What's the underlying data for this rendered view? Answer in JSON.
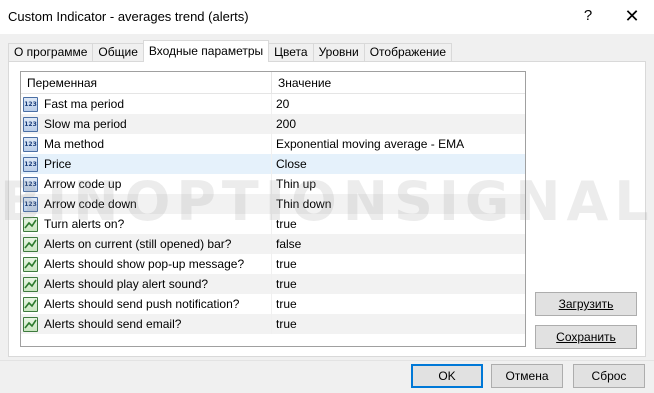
{
  "window": {
    "title": "Custom Indicator - averages trend (alerts)",
    "help_label": "?",
    "close_label": "✕"
  },
  "tabs": [
    {
      "label": "О программе",
      "active": false
    },
    {
      "label": "Общие",
      "active": false
    },
    {
      "label": "Входные параметры",
      "active": true
    },
    {
      "label": "Цвета",
      "active": false
    },
    {
      "label": "Уровни",
      "active": false
    },
    {
      "label": "Отображение",
      "active": false
    }
  ],
  "table": {
    "col_variable": "Переменная",
    "col_value": "Значение",
    "rows": [
      {
        "icon": "number-icon",
        "icon_text": "123",
        "name": "Fast ma period",
        "value": "20"
      },
      {
        "icon": "number-icon",
        "icon_text": "123",
        "name": "Slow ma period",
        "value": "200"
      },
      {
        "icon": "number-icon",
        "icon_text": "123",
        "name": "Ma method",
        "value": "Exponential moving average - EMA"
      },
      {
        "icon": "number-icon",
        "icon_text": "123",
        "name": "Price",
        "value": "Close"
      },
      {
        "icon": "number-icon",
        "icon_text": "123",
        "name": "Arrow code up",
        "value": "Thin up"
      },
      {
        "icon": "number-icon",
        "icon_text": "123",
        "name": "Arrow code down",
        "value": "Thin down"
      },
      {
        "icon": "bool-icon",
        "name": "Turn alerts on?",
        "value": "true"
      },
      {
        "icon": "bool-icon",
        "name": "Alerts on current (still opened) bar?",
        "value": "false"
      },
      {
        "icon": "bool-icon",
        "name": "Alerts should show pop-up message?",
        "value": "true"
      },
      {
        "icon": "bool-icon",
        "name": "Alerts should play alert sound?",
        "value": "true"
      },
      {
        "icon": "bool-icon",
        "name": "Alerts should send push notification?",
        "value": "true"
      },
      {
        "icon": "bool-icon",
        "name": "Alerts should send email?",
        "value": "true"
      }
    ]
  },
  "side_buttons": {
    "load_label": "Загрузить",
    "save_label": "Сохранить"
  },
  "footer": {
    "ok_label": "OK",
    "cancel_label": "Отмена",
    "reset_label": "Сброс"
  },
  "watermark": {
    "text": "BINOPTIONSIGNALS.COM"
  }
}
